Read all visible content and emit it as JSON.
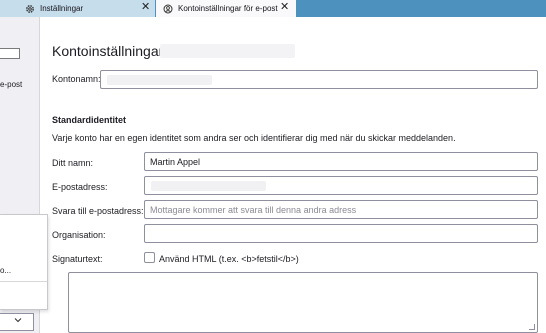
{
  "tabs": [
    {
      "label": "Inställningar",
      "icon": "gear-icon",
      "close": "✕"
    },
    {
      "label": "Kontoinställningar för e-post",
      "icon": "account-icon",
      "close": "✕"
    }
  ],
  "sidebar": {
    "item_text": "e-post",
    "popup_text": "o..."
  },
  "page": {
    "title": "Kontoinställningar -",
    "account_name_label": "Kontonamn:"
  },
  "identity": {
    "heading": "Standardidentitet",
    "description": "Varje konto har en egen identitet som andra ser och identifierar dig med när du skickar meddelanden.",
    "name_label": "Ditt namn:",
    "name_value": "Martin Appel",
    "email_label": "E-postadress:",
    "reply_to_label": "Svara till e-postadress:",
    "reply_to_placeholder": "Mottagare kommer att svara till denna andra adress",
    "organization_label": "Organisation:",
    "signature_label": "Signaturtext:",
    "use_html_label": "Använd HTML (t.ex. <b>fetstil</b>)"
  }
}
